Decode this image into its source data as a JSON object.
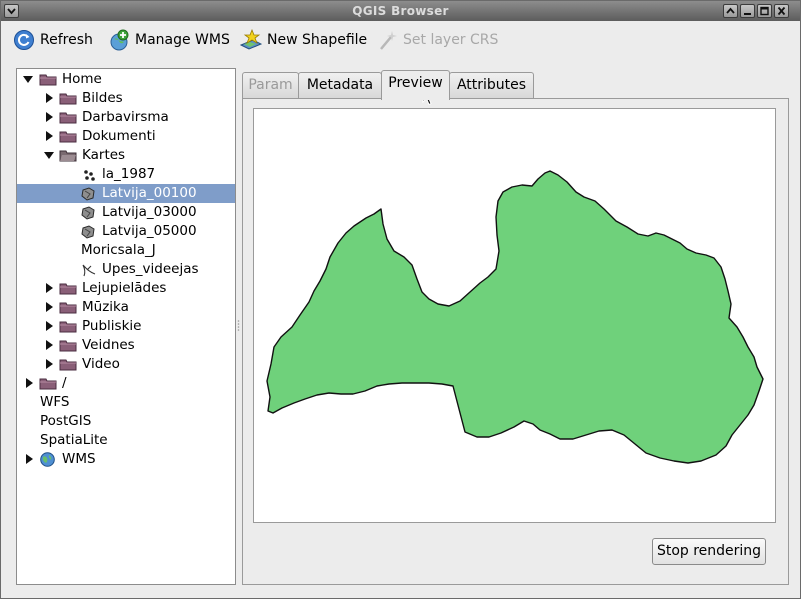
{
  "window": {
    "title": "QGIS Browser"
  },
  "toolbar": {
    "refresh": {
      "label": "Refresh",
      "icon": "refresh-icon"
    },
    "manage_wms": {
      "label": "Manage WMS",
      "icon": "add-wms-icon"
    },
    "new_shapefile": {
      "label": "New Shapefile",
      "icon": "new-shapefile-icon"
    },
    "set_layer_crs": {
      "label": "Set layer CRS",
      "icon": "crs-wand-icon",
      "disabled": true
    }
  },
  "tree": {
    "items": [
      {
        "label": "Home",
        "icon": "folder-icon",
        "expanded": true,
        "depth": 0
      },
      {
        "label": "Bildes",
        "icon": "folder-icon",
        "depth": 1
      },
      {
        "label": "Darbavirsma",
        "icon": "folder-icon",
        "depth": 1
      },
      {
        "label": "Dokumenti",
        "icon": "folder-icon",
        "depth": 1
      },
      {
        "label": "Kartes",
        "icon": "folder-icon",
        "expanded": true,
        "depth": 1
      },
      {
        "label": "la_1987",
        "icon": "point-layer-icon",
        "depth": 2
      },
      {
        "label": "Latvija_00100",
        "icon": "polygon-layer-icon",
        "depth": 2,
        "selected": true
      },
      {
        "label": "Latvija_03000",
        "icon": "polygon-layer-icon",
        "depth": 2
      },
      {
        "label": "Latvija_05000",
        "icon": "polygon-layer-icon",
        "depth": 2
      },
      {
        "label": "Moricsala_J",
        "icon": "none",
        "depth": 2
      },
      {
        "label": "Upes_videejas",
        "icon": "line-layer-icon",
        "depth": 2
      },
      {
        "label": "Lejupielādes",
        "icon": "folder-icon",
        "depth": 1
      },
      {
        "label": "Mūzika",
        "icon": "folder-icon",
        "depth": 1
      },
      {
        "label": "Publiskie",
        "icon": "folder-icon",
        "depth": 1
      },
      {
        "label": "Veidnes",
        "icon": "folder-icon",
        "depth": 1
      },
      {
        "label": "Video",
        "icon": "folder-icon",
        "depth": 1
      },
      {
        "label": "/",
        "icon": "folder-icon",
        "depth": 0
      },
      {
        "label": "WFS",
        "icon": "none",
        "depth": 0
      },
      {
        "label": "PostGIS",
        "icon": "none",
        "depth": 0
      },
      {
        "label": "SpatiaLite",
        "icon": "none",
        "depth": 0
      },
      {
        "label": "WMS",
        "icon": "globe-icon",
        "depth": 0
      }
    ]
  },
  "tabs": [
    {
      "label": "Param",
      "disabled": true
    },
    {
      "label": "Metadata"
    },
    {
      "label": "Preview",
      "active": true
    },
    {
      "label": "Attributes"
    }
  ],
  "preview": {
    "fill_color": "#6fd17b",
    "stroke_color": "#111111"
  },
  "stop_rendering": {
    "label": "Stop rendering"
  },
  "colors": {
    "selection": "#7f9dc9",
    "titlebar": "#6d6d6d"
  }
}
